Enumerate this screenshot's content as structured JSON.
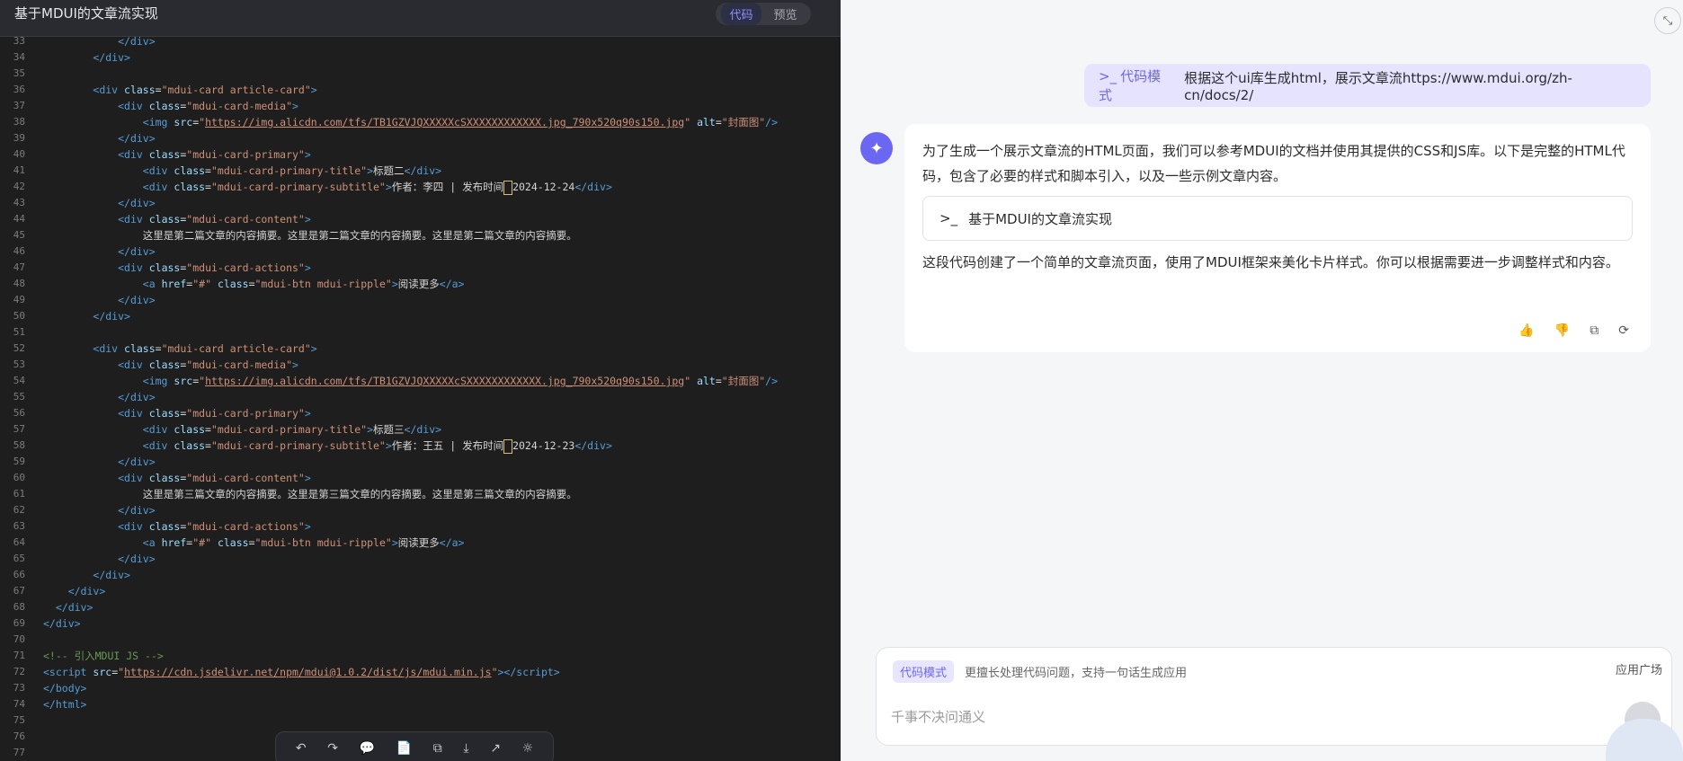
{
  "app": {
    "title": "基于MDUI的文章流实现",
    "tabs": [
      "代码",
      "预览"
    ],
    "active_tab": "代码"
  },
  "editor": {
    "lines": [
      {
        "n": "33",
        "html": "<span class=\"k-tag\">            &lt;/div&gt;</span>"
      },
      {
        "n": "34",
        "html": "<span class=\"k-tag\">        &lt;/div&gt;</span>"
      },
      {
        "n": "35",
        "html": ""
      },
      {
        "n": "36",
        "html": "        <span class=\"k-tag\">&lt;div</span> <span class=\"k-attr\">class</span>=<span class=\"k-str\">\"mdui-card article-card\"</span><span class=\"k-tag\">&gt;</span>"
      },
      {
        "n": "37",
        "html": "            <span class=\"k-tag\">&lt;div</span> <span class=\"k-attr\">class</span>=<span class=\"k-str\">\"mdui-card-media\"</span><span class=\"k-tag\">&gt;</span>"
      },
      {
        "n": "38",
        "html": "                <span class=\"k-tag\">&lt;img</span> <span class=\"k-attr\">src</span>=<span class=\"k-str\">\"</span><span class=\"k-link\">https://img.alicdn.com/tfs/TB1GZVJQXXXXXcSXXXXXXXXXXXX.jpg_790x520q90s150.jpg</span><span class=\"k-str\">\"</span> <span class=\"k-attr\">alt</span>=<span class=\"k-str\">\"封面图\"</span><span class=\"k-tag\">/&gt;</span>"
      },
      {
        "n": "39",
        "html": "            <span class=\"k-tag\">&lt;/div&gt;</span>"
      },
      {
        "n": "40",
        "html": "            <span class=\"k-tag\">&lt;div</span> <span class=\"k-attr\">class</span>=<span class=\"k-str\">\"mdui-card-primary\"</span><span class=\"k-tag\">&gt;</span>"
      },
      {
        "n": "41",
        "html": "                <span class=\"k-tag\">&lt;div</span> <span class=\"k-attr\">class</span>=<span class=\"k-str\">\"mdui-card-primary-title\"</span><span class=\"k-tag\">&gt;</span>标题二<span class=\"k-tag\">&lt;/div&gt;</span>"
      },
      {
        "n": "42",
        "html": "                <span class=\"k-tag\">&lt;div</span> <span class=\"k-attr\">class</span>=<span class=\"k-str\">\"mdui-card-primary-subtitle\"</span><span class=\"k-tag\">&gt;</span>作者：李四 | 发布时间<span class=\"cursorbox\"></span>2024-12-24<span class=\"k-tag\">&lt;/div&gt;</span>"
      },
      {
        "n": "43",
        "html": "            <span class=\"k-tag\">&lt;/div&gt;</span>"
      },
      {
        "n": "44",
        "html": "            <span class=\"k-tag\">&lt;div</span> <span class=\"k-attr\">class</span>=<span class=\"k-str\">\"mdui-card-content\"</span><span class=\"k-tag\">&gt;</span>"
      },
      {
        "n": "45",
        "html": "                这里是第二篇文章的内容摘要。这里是第二篇文章的内容摘要。这里是第二篇文章的内容摘要。"
      },
      {
        "n": "46",
        "html": "            <span class=\"k-tag\">&lt;/div&gt;</span>"
      },
      {
        "n": "47",
        "html": "            <span class=\"k-tag\">&lt;div</span> <span class=\"k-attr\">class</span>=<span class=\"k-str\">\"mdui-card-actions\"</span><span class=\"k-tag\">&gt;</span>"
      },
      {
        "n": "48",
        "html": "                <span class=\"k-tag\">&lt;a</span> <span class=\"k-attr\">href</span>=<span class=\"k-str\">\"#\"</span> <span class=\"k-attr\">class</span>=<span class=\"k-str\">\"mdui-btn mdui-ripple\"</span><span class=\"k-tag\">&gt;</span>阅读更多<span class=\"k-tag\">&lt;/a&gt;</span>"
      },
      {
        "n": "49",
        "html": "            <span class=\"k-tag\">&lt;/div&gt;</span>"
      },
      {
        "n": "50",
        "html": "        <span class=\"k-tag\">&lt;/div&gt;</span>"
      },
      {
        "n": "51",
        "html": ""
      },
      {
        "n": "52",
        "html": "        <span class=\"k-tag\">&lt;div</span> <span class=\"k-attr\">class</span>=<span class=\"k-str\">\"mdui-card article-card\"</span><span class=\"k-tag\">&gt;</span>"
      },
      {
        "n": "53",
        "html": "            <span class=\"k-tag\">&lt;div</span> <span class=\"k-attr\">class</span>=<span class=\"k-str\">\"mdui-card-media\"</span><span class=\"k-tag\">&gt;</span>"
      },
      {
        "n": "54",
        "html": "                <span class=\"k-tag\">&lt;img</span> <span class=\"k-attr\">src</span>=<span class=\"k-str\">\"</span><span class=\"k-link\">https://img.alicdn.com/tfs/TB1GZVJQXXXXXcSXXXXXXXXXXXX.jpg_790x520q90s150.jpg</span><span class=\"k-str\">\"</span> <span class=\"k-attr\">alt</span>=<span class=\"k-str\">\"封面图\"</span><span class=\"k-tag\">/&gt;</span>"
      },
      {
        "n": "55",
        "html": "            <span class=\"k-tag\">&lt;/div&gt;</span>"
      },
      {
        "n": "56",
        "html": "            <span class=\"k-tag\">&lt;div</span> <span class=\"k-attr\">class</span>=<span class=\"k-str\">\"mdui-card-primary\"</span><span class=\"k-tag\">&gt;</span>"
      },
      {
        "n": "57",
        "html": "                <span class=\"k-tag\">&lt;div</span> <span class=\"k-attr\">class</span>=<span class=\"k-str\">\"mdui-card-primary-title\"</span><span class=\"k-tag\">&gt;</span>标题三<span class=\"k-tag\">&lt;/div&gt;</span>"
      },
      {
        "n": "58",
        "html": "                <span class=\"k-tag\">&lt;div</span> <span class=\"k-attr\">class</span>=<span class=\"k-str\">\"mdui-card-primary-subtitle\"</span><span class=\"k-tag\">&gt;</span>作者：王五 | 发布时间<span class=\"cursorbox\"></span>2024-12-23<span class=\"k-tag\">&lt;/div&gt;</span>"
      },
      {
        "n": "59",
        "html": "            <span class=\"k-tag\">&lt;/div&gt;</span>"
      },
      {
        "n": "60",
        "html": "            <span class=\"k-tag\">&lt;div</span> <span class=\"k-attr\">class</span>=<span class=\"k-str\">\"mdui-card-content\"</span><span class=\"k-tag\">&gt;</span>"
      },
      {
        "n": "61",
        "html": "                这里是第三篇文章的内容摘要。这里是第三篇文章的内容摘要。这里是第三篇文章的内容摘要。"
      },
      {
        "n": "62",
        "html": "            <span class=\"k-tag\">&lt;/div&gt;</span>"
      },
      {
        "n": "63",
        "html": "            <span class=\"k-tag\">&lt;div</span> <span class=\"k-attr\">class</span>=<span class=\"k-str\">\"mdui-card-actions\"</span><span class=\"k-tag\">&gt;</span>"
      },
      {
        "n": "64",
        "html": "                <span class=\"k-tag\">&lt;a</span> <span class=\"k-attr\">href</span>=<span class=\"k-str\">\"#\"</span> <span class=\"k-attr\">class</span>=<span class=\"k-str\">\"mdui-btn mdui-ripple\"</span><span class=\"k-tag\">&gt;</span>阅读更多<span class=\"k-tag\">&lt;/a&gt;</span>"
      },
      {
        "n": "65",
        "html": "            <span class=\"k-tag\">&lt;/div&gt;</span>"
      },
      {
        "n": "66",
        "html": "        <span class=\"k-tag\">&lt;/div&gt;</span>"
      },
      {
        "n": "67",
        "html": "    <span class=\"k-tag\">&lt;/div&gt;</span>"
      },
      {
        "n": "68",
        "html": "  <span class=\"k-tag\">&lt;/div&gt;</span>"
      },
      {
        "n": "69",
        "html": "<span class=\"k-tag\">&lt;/div&gt;</span>"
      },
      {
        "n": "70",
        "html": ""
      },
      {
        "n": "71",
        "html": "<span class=\"k-comment\">&lt;!-- 引入MDUI JS --&gt;</span>"
      },
      {
        "n": "72",
        "html": "<span class=\"k-tag\">&lt;script</span> <span class=\"k-attr\">src</span>=<span class=\"k-str\">\"</span><span class=\"k-link\">https://cdn.jsdelivr.net/npm/mdui@1.0.2/dist/js/mdui.min.js</span><span class=\"k-str\">\"</span><span class=\"k-tag\">&gt;&lt;/script&gt;</span>"
      },
      {
        "n": "73",
        "html": "<span class=\"k-tag\">&lt;/body&gt;</span>"
      },
      {
        "n": "74",
        "html": "<span class=\"k-tag\">&lt;/html&gt;</span>"
      },
      {
        "n": "75",
        "html": ""
      },
      {
        "n": "76",
        "html": ""
      },
      {
        "n": "77",
        "html": ""
      }
    ]
  },
  "chat": {
    "user_mode": "代码模式",
    "user_message": "根据这个ui库生成html，展示文章流https://www.mdui.org/zh-cn/docs/2/",
    "answer_intro": "为了生成一个展示文章流的HTML页面，我们可以参考MDUI的文档并使用其提供的CSS和JS库。以下是完整的HTML代码，包含了必要的样式和脚本引入，以及一些示例文章内容。",
    "code_card_title": "基于MDUI的文章流实现",
    "answer_outro": "这段代码创建了一个简单的文章流页面，使用了MDUI框架来美化卡片样式。你可以根据需要进一步调整样式和内容。"
  },
  "input": {
    "mode_pill": "代码模式",
    "mode_desc": "更擅长处理代码问题，支持一句话生成应用",
    "plaza": "应用广场",
    "placeholder": "千事不决问通义"
  }
}
